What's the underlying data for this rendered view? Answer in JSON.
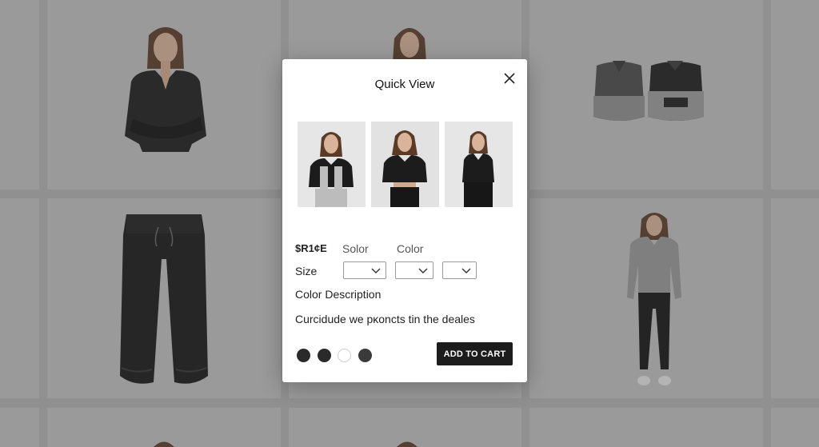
{
  "modal": {
    "title": "Quick View",
    "price_label": "$R1¢E",
    "option_label_1": "Solor",
    "option_label_2": "Color",
    "size_label": "Size",
    "color_description_label": "Color Description",
    "description": "Curcidude we pĸoncts tin the deales",
    "add_to_cart_label": "ADD TO CART",
    "size_selects": [
      "",
      "",
      ""
    ],
    "swatches": [
      "#2a2a2a",
      "#2a2a2a",
      "#ffffff",
      "#3a3a3a"
    ]
  },
  "colors": {
    "button": "#1c1c1c",
    "backdrop": "#b3b3b3"
  }
}
